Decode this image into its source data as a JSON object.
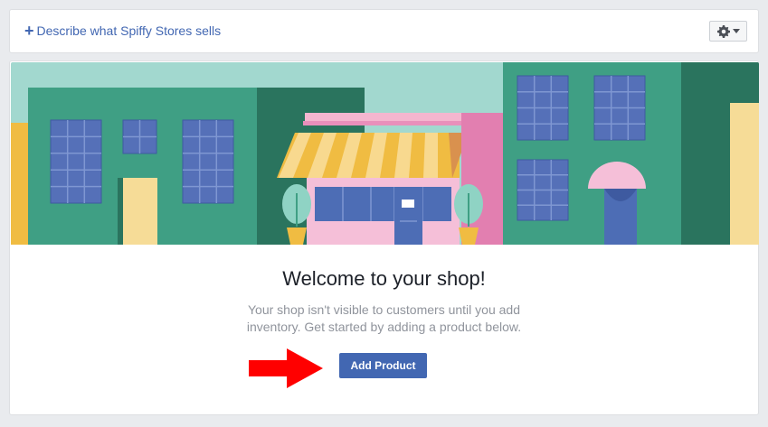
{
  "header": {
    "describe_link_prefix": "+",
    "describe_link_text": "Describe what Spiffy Stores sells",
    "settings_icon": "gear-icon",
    "settings_caret_icon": "caret-down-icon"
  },
  "main": {
    "banner_image": "storefront-illustration",
    "title": "Welcome to your shop!",
    "description": "Your shop isn't visible to customers until you add inventory. Get started by adding a product below.",
    "add_product_label": "Add Product",
    "pointer_icon": "red-arrow-right-icon"
  },
  "colors": {
    "link_blue": "#4267b2",
    "button_blue": "#4267b2",
    "page_bg": "#e9ebee",
    "arrow_red": "#ff0000"
  }
}
